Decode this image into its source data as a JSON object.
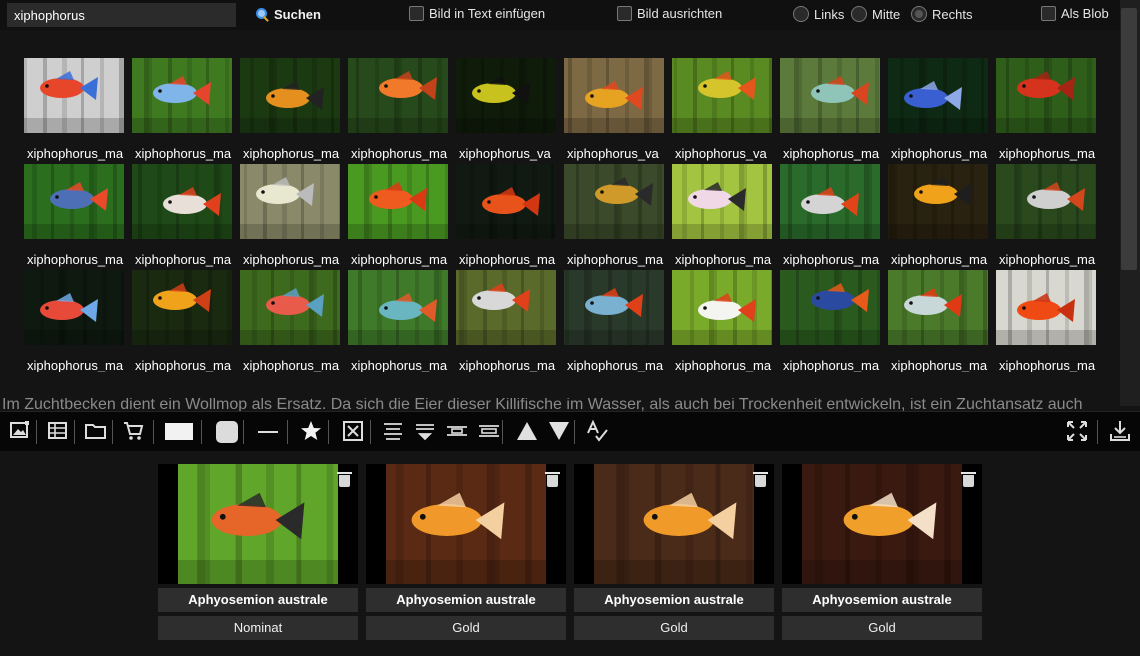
{
  "search": {
    "value": "xiphophorus",
    "button_label": "Suchen"
  },
  "options": {
    "insert_in_text": "Bild in Text einfügen",
    "align_image": "Bild ausrichten",
    "align_left": "Links",
    "align_center": "Mitte",
    "align_right": "Rechts",
    "as_blob": "Als Blob"
  },
  "grid": {
    "rows": [
      {
        "captions": [
          "xiphophorus_ma",
          "xiphophorus_ma",
          "xiphophorus_ma",
          "xiphophorus_ma",
          "xiphophorus_va",
          "xiphophorus_va",
          "xiphophorus_va",
          "xiphophorus_ma",
          "xiphophorus_ma",
          "xiphophorus_ma"
        ],
        "palette": [
          {
            "bg": "#cfcfcf",
            "fish": "#e8462a",
            "accent": "#3a6fd8"
          },
          {
            "bg": "#3f7a21",
            "fish": "#7fb5e8",
            "accent": "#e6452d"
          },
          {
            "bg": "#1c3a12",
            "fish": "#e58f1f",
            "accent": "#222222"
          },
          {
            "bg": "#274a1c",
            "fish": "#f07a2a",
            "accent": "#c4421a"
          },
          {
            "bg": "#0f1c0a",
            "fish": "#c8c21e",
            "accent": "#111111"
          },
          {
            "bg": "#7d6a44",
            "fish": "#e5a321",
            "accent": "#e0481f"
          },
          {
            "bg": "#5a8a22",
            "fish": "#d6c42c",
            "accent": "#e4561c"
          },
          {
            "bg": "#5c7a3b",
            "fish": "#8fc4b8",
            "accent": "#d8451f"
          },
          {
            "bg": "#0f2a14",
            "fish": "#3a5fd0",
            "accent": "#8fa8e8"
          },
          {
            "bg": "#2f5e1a",
            "fish": "#d6331c",
            "accent": "#a52414"
          }
        ]
      },
      {
        "captions": [
          "xiphophorus_ma",
          "xiphophorus_ma",
          "xiphophorus_ma",
          "xiphophorus_ma",
          "xiphophorus_ma",
          "xiphophorus_ma",
          "xiphophorus_ma",
          "xiphophorus_ma",
          "xiphophorus_ma",
          "xiphophorus_ma"
        ],
        "palette": [
          {
            "bg": "#2b6e1e",
            "fish": "#4d6fb5",
            "accent": "#e84a2a"
          },
          {
            "bg": "#1f4a18",
            "fish": "#e8e0d8",
            "accent": "#e0401e"
          },
          {
            "bg": "#8a8a6a",
            "fish": "#e8e8d0",
            "accent": "#bbbbbb"
          },
          {
            "bg": "#4a9a22",
            "fish": "#ef5a1f",
            "accent": "#d93a14"
          },
          {
            "bg": "#101a12",
            "fish": "#e8531c",
            "accent": "#d33712"
          },
          {
            "bg": "#3a4a2a",
            "fish": "#cf9a2a",
            "accent": "#2a2a2a"
          },
          {
            "bg": "#a2c440",
            "fish": "#f0d8e6",
            "accent": "#2a2a2a"
          },
          {
            "bg": "#2a6a2a",
            "fish": "#d4d4d4",
            "accent": "#e04418"
          },
          {
            "bg": "#2a2210",
            "fish": "#f0a21a",
            "accent": "#1e1e1e"
          },
          {
            "bg": "#2a4a1e",
            "fish": "#cfcfcf",
            "accent": "#d4471c"
          }
        ]
      },
      {
        "captions": [
          "xiphophorus_ma",
          "xiphophorus_ma",
          "xiphophorus_ma",
          "xiphophorus_ma",
          "xiphophorus_ma",
          "xiphophorus_ma",
          "xiphophorus_ma",
          "xiphophorus_ma",
          "xiphophorus_ma",
          "xiphophorus_ma"
        ],
        "palette": [
          {
            "bg": "#0e1a10",
            "fish": "#e84a3a",
            "accent": "#6fa8e6"
          },
          {
            "bg": "#1a2a10",
            "fish": "#f0a21a",
            "accent": "#d04016"
          },
          {
            "bg": "#3e6a1e",
            "fish": "#e85a4a",
            "accent": "#5aa0c0"
          },
          {
            "bg": "#3f7a2a",
            "fish": "#6ab6c0",
            "accent": "#e05a2a"
          },
          {
            "bg": "#5a6a2a",
            "fish": "#d8d8d8",
            "accent": "#e0401a"
          },
          {
            "bg": "#2a3a2a",
            "fish": "#7ab0d0",
            "accent": "#e04018"
          },
          {
            "bg": "#7aaa2a",
            "fish": "#f4f4f0",
            "accent": "#e0401a"
          },
          {
            "bg": "#2a5a1e",
            "fish": "#2a4aa0",
            "accent": "#e85a1a"
          },
          {
            "bg": "#4a7a2a",
            "fish": "#c8d8d8",
            "accent": "#e03a14"
          },
          {
            "bg": "#d8d8d0",
            "fish": "#ef4a14",
            "accent": "#c83010"
          }
        ]
      },
      {
        "captions": [
          "xiphophorus_ma",
          "xiphophorus_ma",
          "xiphophorus_ma",
          "xiphophorus_ma",
          "xiphophorus_ma",
          "xiphophorus_ma",
          "xiphophorus_ma",
          "xiphophorus_ma",
          "xiphophorus_ma",
          "xiphophorus_ma"
        ],
        "palette": [
          {
            "bg": "#2a4a1e",
            "fish": "#e85a2a",
            "accent": "#e8e8e8"
          },
          {
            "bg": "#1e2a14",
            "fish": "#e85a2a",
            "accent": "#e8e8e8"
          },
          {
            "bg": "#3a6a1e",
            "fish": "#e8a22a",
            "accent": "#e8e8e8"
          },
          {
            "bg": "#2a4a1e",
            "fish": "#e85a2a",
            "accent": "#e8e8e8"
          },
          {
            "bg": "#1e2a14",
            "fish": "#e8c22a",
            "accent": "#e8e8e8"
          },
          {
            "bg": "#3a4a2a",
            "fish": "#e8a22a",
            "accent": "#e8e8e8"
          },
          {
            "bg": "#4a6a2a",
            "fish": "#e8e8e8",
            "accent": "#e8e8e8"
          },
          {
            "bg": "#2a5a2a",
            "fish": "#e8e8e8",
            "accent": "#e8e8e8"
          },
          {
            "bg": "#3a3a1e",
            "fish": "#e8a22a",
            "accent": "#e8e8e8"
          },
          {
            "bg": "#2a3a1e",
            "fish": "#e8a22a",
            "accent": "#e8e8e8"
          }
        ]
      }
    ]
  },
  "overlay_text": "Im Zuchtbecken dient ein Wollmop als Ersatz. Da sich die Eier dieser Killifische im Wasser, als auch bei Trockenheit entwickeln, ist ein Zuchtansatz auch",
  "toolbar": {
    "left": [
      "image-icon",
      "table-icon",
      "folder-icon",
      "cart-icon",
      "rectangle-icon",
      "rounded-rectangle-icon",
      "horizontal-line-icon",
      "star-icon",
      "close-box-icon",
      "align-top-icon",
      "align-bottom-icon",
      "align-middle-icon",
      "align-center-icon",
      "arrow-up-icon",
      "arrow-down-icon",
      "spellcheck-icon"
    ],
    "right": [
      "fullscreen-icon",
      "download-icon"
    ]
  },
  "selected": [
    {
      "title": "Aphyosemion australe",
      "subtitle": "Nominat",
      "bg": "#5fa62a",
      "fish": "#e6662a",
      "accent": "#2a2a2a"
    },
    {
      "title": "Aphyosemion australe",
      "subtitle": "Gold",
      "bg": "#5a2a14",
      "fish": "#f0982a",
      "accent": "#f4d0a0"
    },
    {
      "title": "Aphyosemion australe",
      "subtitle": "Gold",
      "bg": "#4a2a18",
      "fish": "#f09a2a",
      "accent": "#f4d0a0"
    },
    {
      "title": "Aphyosemion australe",
      "subtitle": "Gold",
      "bg": "#3a1a10",
      "fish": "#f0a02a",
      "accent": "#f4e0c8"
    }
  ]
}
